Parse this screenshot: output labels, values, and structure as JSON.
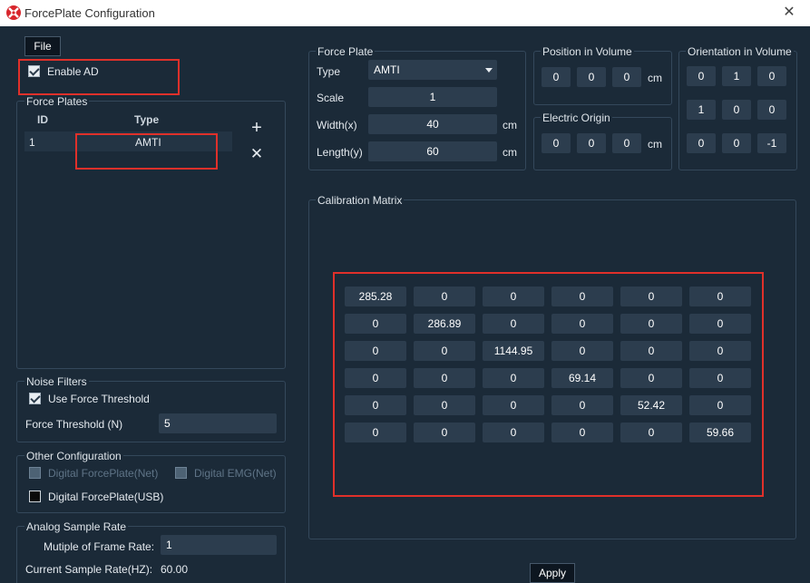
{
  "window": {
    "title": "ForcePlate Configuration",
    "close_glyph": "✕"
  },
  "menu": {
    "file_label": "File"
  },
  "enable_ad": {
    "label": "Enable AD",
    "checked": true
  },
  "force_plates": {
    "title": "Force Plates",
    "columns": [
      "ID",
      "Type"
    ],
    "rows": [
      {
        "id": "1",
        "type": "AMTI"
      }
    ],
    "add_glyph": "+",
    "remove_glyph": "✕"
  },
  "noise_filters": {
    "title": "Noise Filters",
    "use_force_threshold": {
      "label": "Use Force Threshold",
      "checked": true
    },
    "force_threshold_label": "Force Threshold (N)",
    "force_threshold_value": "5"
  },
  "other_config": {
    "title": "Other Configuration",
    "digital_forceplate_net": {
      "label": "Digital ForcePlate(Net)",
      "enabled": false
    },
    "digital_emg_net": {
      "label": "Digital EMG(Net)",
      "enabled": false
    },
    "digital_forceplate_usb": {
      "label": "Digital ForcePlate(USB)",
      "checked": false
    }
  },
  "analog_rate": {
    "title": "Analog Sample Rate",
    "multiple_label": "Mutiple of Frame Rate:",
    "multiple_value": "1",
    "current_label": "Current Sample Rate(HZ):",
    "current_value": "60.00"
  },
  "force_plate": {
    "title": "Force Plate",
    "type_label": "Type",
    "type_value": "AMTI",
    "scale_label": "Scale",
    "scale_value": "1",
    "width_label": "Width(x)",
    "width_value": "40",
    "length_label": "Length(y)",
    "length_value": "60",
    "unit": "cm"
  },
  "position": {
    "title": "Position in Volume",
    "values": [
      "0",
      "0",
      "0"
    ],
    "unit": "cm"
  },
  "electric_origin": {
    "title": "Electric Origin",
    "values": [
      "0",
      "0",
      "0"
    ],
    "unit": "cm"
  },
  "orientation": {
    "title": "Orientation in Volume",
    "rows": [
      [
        "0",
        "1",
        "0"
      ],
      [
        "1",
        "0",
        "0"
      ],
      [
        "0",
        "0",
        "-1"
      ]
    ]
  },
  "calibration": {
    "title": "Calibration Matrix",
    "rows": [
      [
        "285.28",
        "0",
        "0",
        "0",
        "0",
        "0"
      ],
      [
        "0",
        "286.89",
        "0",
        "0",
        "0",
        "0"
      ],
      [
        "0",
        "0",
        "1144.95",
        "0",
        "0",
        "0"
      ],
      [
        "0",
        "0",
        "0",
        "69.14",
        "0",
        "0"
      ],
      [
        "0",
        "0",
        "0",
        "0",
        "52.42",
        "0"
      ],
      [
        "0",
        "0",
        "0",
        "0",
        "0",
        "59.66"
      ]
    ]
  },
  "apply_label": "Apply",
  "colors": {
    "background": "#1b2a38",
    "field": "#2c3d4e",
    "highlight_red": "#e0302a"
  }
}
